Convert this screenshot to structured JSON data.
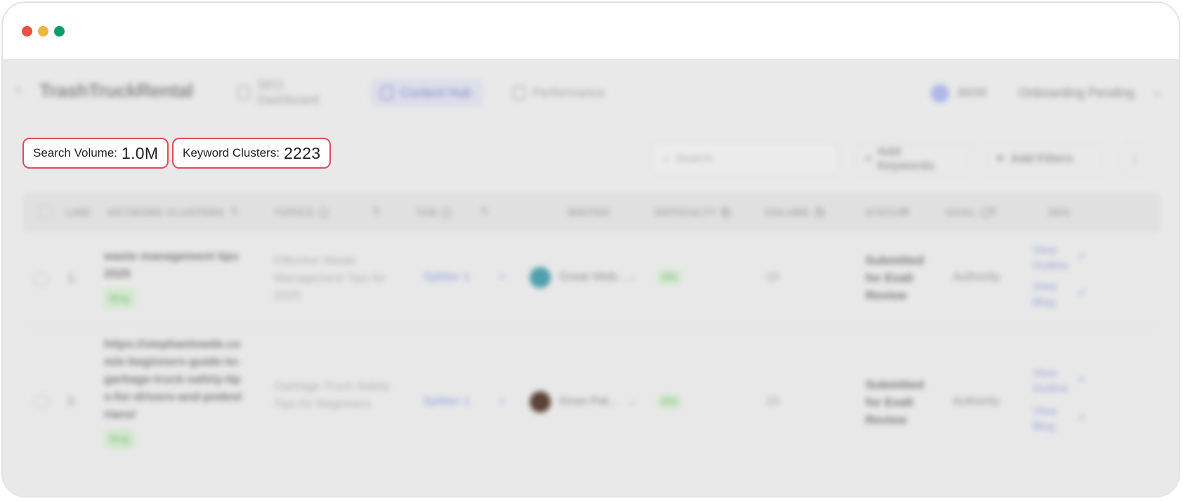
{
  "window": {
    "controls": [
      "close",
      "minimize",
      "maximize"
    ]
  },
  "nav": {
    "brand": "TrashTruckRental",
    "tabs": [
      {
        "label": "SEO Dashboard",
        "icon": "clipboard-icon"
      },
      {
        "label": "Content Hub",
        "icon": "grid-icon",
        "active": true
      },
      {
        "label": "Performance",
        "icon": "chart-icon"
      }
    ],
    "credits": "30/30",
    "onboarding": "Onboarding Pending"
  },
  "stats": {
    "search_volume_label": "Search Volume:",
    "search_volume_value": "1.0M",
    "keyword_clusters_label": "Keyword Clusters:",
    "keyword_clusters_value": "2223"
  },
  "toolbar": {
    "search_placeholder": "Search",
    "add_keywords": "Add Keywords",
    "add_filters": "Add Filters"
  },
  "table": {
    "headers": {
      "line": "LINE",
      "keyword": "KEYWORD CLUSTERS",
      "topics": "TOPICS",
      "tab": "TAB",
      "writer": "WRITER",
      "difficulty": "DIFFICULTY",
      "volume": "VOLUME",
      "status": "STATUS",
      "goal": "GOAL",
      "seo": "SEO"
    },
    "rows": [
      {
        "line": "1.",
        "keyword": "waste management tips 2025",
        "type": "Blog",
        "topic": "Effective Waste Management Tips for 2025",
        "tab": "Splitter 1",
        "writer": "Great Web...",
        "difficulty": "0%",
        "volume": "10",
        "status": "Submitted for Exalt Review",
        "goal": "Authority",
        "link1": "View Outline",
        "link2": "View Blog"
      },
      {
        "line": "2.",
        "keyword": "https://stephanlowde.com/e-beginners-guide-to-garbage-truck-safety-tips-for-drivers-and-pedestrians/",
        "type": "Blog",
        "topic": "Garbage Truck Safety Tips for Beginners",
        "tab": "Splitter 1",
        "writer": "Kiran Pat...",
        "difficulty": "0%",
        "volume": "10",
        "status": "Submitted for Exalt Review",
        "goal": "Authority",
        "link1": "View Outline",
        "link2": "View Blog"
      }
    ]
  }
}
